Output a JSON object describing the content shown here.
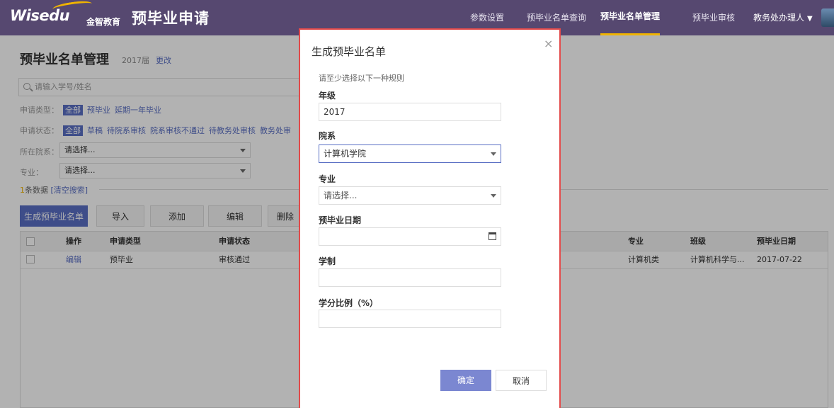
{
  "header": {
    "logo_text": "Wisedu",
    "logo_cn": "金智教育",
    "app_title": "预毕业申请",
    "nav": [
      "参数设置",
      "预毕业名单查询",
      "预毕业名单管理",
      "预毕业审核"
    ],
    "user": "教务处办理人"
  },
  "page": {
    "title": "预毕业名单管理",
    "year": "2017届",
    "change": "更改",
    "search_placeholder": "请输入学号/姓名",
    "type_label": "申请类型：",
    "type_options": [
      "全部",
      "预毕业",
      "延期一年毕业"
    ],
    "status_label": "申请状态：",
    "status_options": [
      "全部",
      "草稿",
      "待院系审核",
      "院系审核不通过",
      "待教务处审核",
      "教务处审"
    ],
    "dept_label": "所在院系：",
    "dept_placeholder": "请选择...",
    "major_label": "专业：",
    "major_placeholder": "请选择...",
    "count_num": "1",
    "count_text": "条数据",
    "clear": "[清空搜索]",
    "buttons": [
      "生成预毕业名单",
      "导入",
      "添加",
      "编辑",
      "删除"
    ],
    "table": {
      "headers": [
        "操作",
        "申请类型",
        "申请状态",
        "专业",
        "班级",
        "预毕业日期"
      ],
      "row": [
        "编辑",
        "预毕业",
        "审核通过",
        "计算机类",
        "计算机科学与...",
        "2017-07-22"
      ]
    }
  },
  "modal": {
    "title": "生成预毕业名单",
    "close": "×",
    "hint": "请至少选择以下一种规则",
    "grade_label": "年级",
    "grade_value": "2017",
    "dept_label": "院系",
    "dept_value": "计算机学院",
    "major_label": "专业",
    "major_value": "请选择...",
    "date_label": "预毕业日期",
    "system_label": "学制",
    "credit_label": "学分比例（%）",
    "ok": "确定",
    "cancel": "取消"
  }
}
